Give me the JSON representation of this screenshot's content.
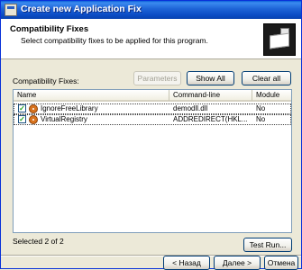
{
  "window": {
    "title": "Create new Application Fix"
  },
  "header": {
    "title": "Compatibility Fixes",
    "subtitle": "Select compatibility fixes to be applied for this program.",
    "icon": "computer-plug-icon"
  },
  "fixes": {
    "label": "Compatibility Fixes:",
    "parameters_label": "Parameters",
    "show_all_label": "Show All",
    "clear_all_label": "Clear all",
    "columns": [
      "Name",
      "Command-line",
      "Module"
    ],
    "rows": [
      {
        "name": "IgnoreFreeLibrary",
        "command_line": "demodll.dll",
        "module": "No",
        "checked": true
      },
      {
        "name": "VirtualRegistry",
        "command_line": "ADDREDIRECT(HKL...",
        "module": "No",
        "checked": true
      }
    ],
    "selected_text": "Selected 2 of 2",
    "test_run_label": "Test Run..."
  },
  "nav": {
    "back_label": "< Назад",
    "next_label": "Далее >",
    "cancel_label": "Отмена"
  }
}
